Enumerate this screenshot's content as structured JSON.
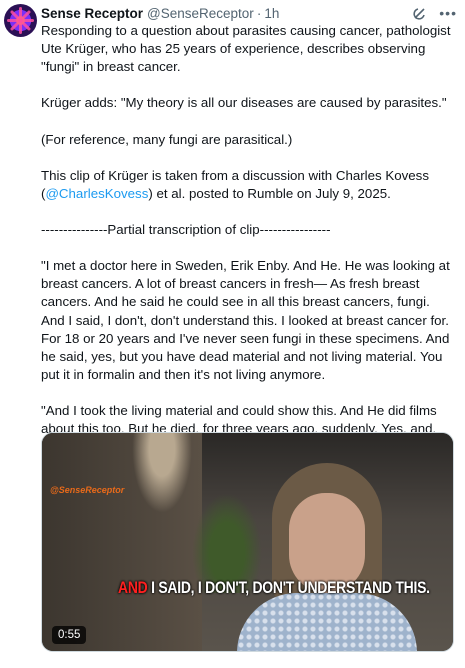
{
  "author": {
    "name": "Sense Receptor",
    "handle": "@SenseReceptor",
    "separator": "·",
    "time": "1h"
  },
  "tweet": {
    "p1": "Responding to a question about parasites causing cancer, pathologist Ute Krüger, who has 25 years of experience, describes observing \"fungi\" in breast cancer.",
    "p2": "Krüger adds: \"My theory is all our diseases are caused by parasites.\"",
    "p3": "(For reference, many fungi are parasitical.)",
    "p4_before": "This clip of Krüger is taken from a discussion with Charles Kovess (",
    "p4_link": "@CharlesKovess",
    "p4_after": ") et al. posted to Rumble on July 9, 2025.",
    "p5": "---------------Partial transcription of clip----------------",
    "p6": "\"I met a doctor here in Sweden, Erik Enby. And He. He was looking at breast cancers. A lot of breast cancers in fresh— As fresh breast cancers. And he said he could see in all this breast cancers, fungi. And I said, I don't, don't understand this. I looked at breast cancer for. For 18 or 20 years and I've never seen fungi in these specimens. And he said, yes, but you have dead material and not living material. You put it in formalin and then it's not living anymore.",
    "p7": "\"And I took the living material and could show this. And He did films about this too. But he died, for three years ago, suddenly. Yes, and. Exactly. And I have done a course in Berlin for four months about parasites. And I think my theory is all our diseases are caused by parasites.\""
  },
  "media": {
    "watermark": "@SenseReceptor",
    "caption_red": "AND",
    "caption_white": " I SAID, I DON'T, DON'T UNDERSTAND THIS.",
    "duration": "0:55"
  },
  "icons": {
    "grok": "grok-icon",
    "more": "more-icon"
  },
  "colors": {
    "link": "#1d9bf0",
    "secondary_text": "#536471",
    "caption_accent": "#ff2020"
  }
}
